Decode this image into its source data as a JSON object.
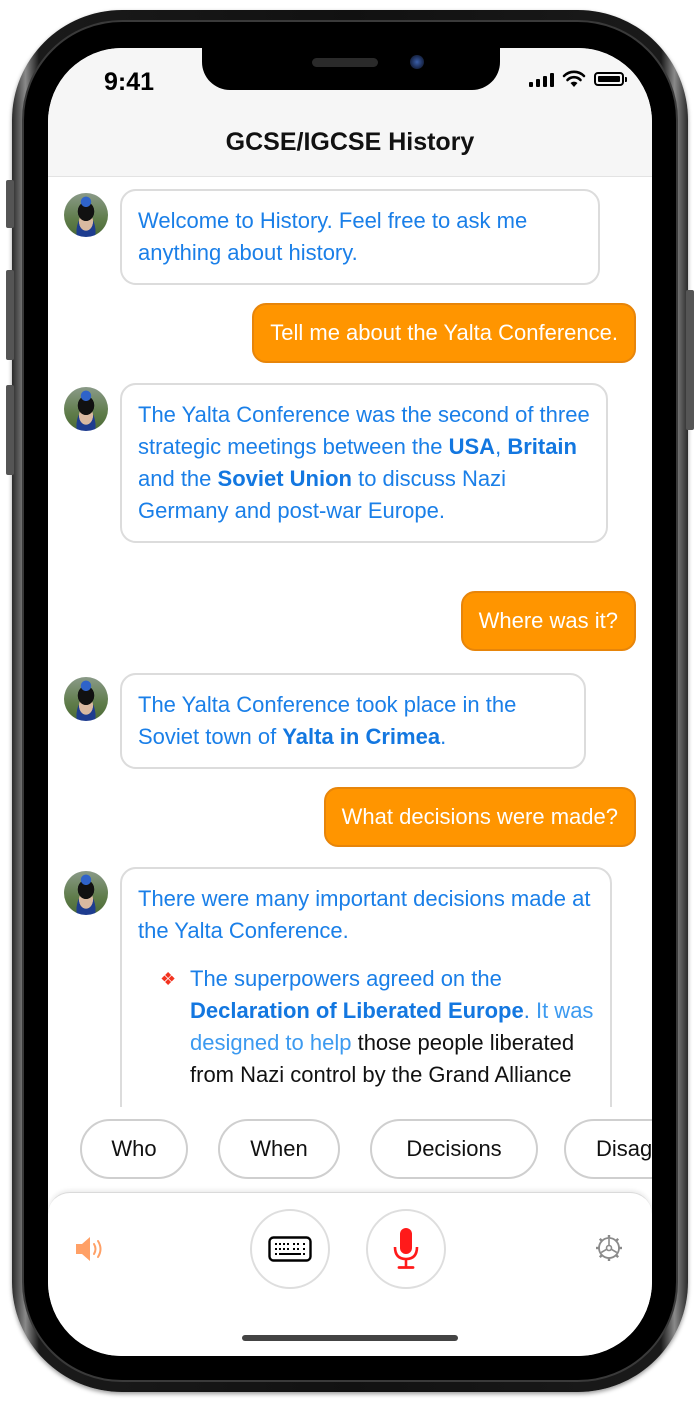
{
  "status_bar": {
    "time": "9:41"
  },
  "header": {
    "title": "GCSE/IGCSE History"
  },
  "conversation": [
    {
      "role": "bot",
      "segments": [
        {
          "text": "Welcome to History. Feel free to ask me anything about history.",
          "bold": false
        }
      ]
    },
    {
      "role": "user",
      "text": "Tell me about the Yalta Conference."
    },
    {
      "role": "bot",
      "segments": [
        {
          "text": "The Yalta Conference was the second of three strategic meetings between the ",
          "bold": false
        },
        {
          "text": "USA",
          "bold": true
        },
        {
          "text": ", ",
          "bold": false
        },
        {
          "text": "Britain",
          "bold": true
        },
        {
          "text": " and the ",
          "bold": false
        },
        {
          "text": "Soviet Union",
          "bold": true
        },
        {
          "text": " to discuss Nazi Germany and post-war Europe.",
          "bold": false
        }
      ]
    },
    {
      "role": "user",
      "text": "Where was it?"
    },
    {
      "role": "bot",
      "segments": [
        {
          "text": "The Yalta Conference took place in the Soviet town of ",
          "bold": false
        },
        {
          "text": "Yalta in Crimea",
          "bold": true
        },
        {
          "text": ".",
          "bold": false
        }
      ]
    },
    {
      "role": "user",
      "text": "What decisions were made?"
    },
    {
      "role": "bot",
      "intro": "There were many important decisions made at the Yalta Conference.",
      "bullet_icon": "red-diamond-bullet",
      "bullets": [
        {
          "segments": [
            {
              "text": "The superpowers agreed on the ",
              "style": "blue"
            },
            {
              "text": "Declaration of Liberated Europe",
              "style": "bold"
            },
            {
              "text": ". ",
              "style": "blue"
            },
            {
              "text": "It was designed to help",
              "style": "light"
            },
            {
              "text": " those people liberated from Nazi control by the Grand Alliance",
              "style": "dark"
            }
          ]
        }
      ]
    }
  ],
  "suggestions": [
    "Who",
    "When",
    "Decisions",
    "Disagreements"
  ],
  "toolbar": {
    "speaker_icon": "speaker-icon",
    "keyboard_icon": "keyboard-icon",
    "mic_icon": "microphone-icon",
    "settings_icon": "gear-icon"
  },
  "colors": {
    "bot_text": "#1a7fe8",
    "user_bubble": "#ff9500",
    "mic": "#ff1a1a",
    "speaker": "#ffa066",
    "bullet": "#f2331f"
  }
}
